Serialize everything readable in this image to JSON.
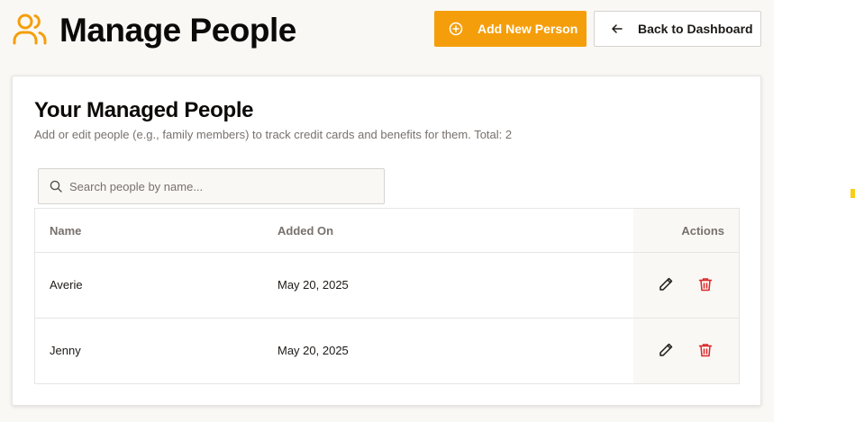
{
  "header": {
    "title": "Manage People",
    "title_icon": "users-icon",
    "add_button_label": "Add New Person",
    "back_button_label": "Back to Dashboard"
  },
  "card": {
    "title": "Your Managed People",
    "subtitle": "Add or edit people (e.g., family members) to track credit cards and benefits for them. Total: 2"
  },
  "search": {
    "placeholder": "Search people by name...",
    "value": ""
  },
  "table": {
    "columns": [
      "Name",
      "Added On",
      "Actions"
    ],
    "rows": [
      {
        "name": "Averie",
        "added_on": "May 20, 2025"
      },
      {
        "name": "Jenny",
        "added_on": "May 20, 2025"
      }
    ]
  },
  "colors": {
    "accent": "#f59e0b",
    "delete": "#dc2626",
    "background": "#faf8f5"
  }
}
